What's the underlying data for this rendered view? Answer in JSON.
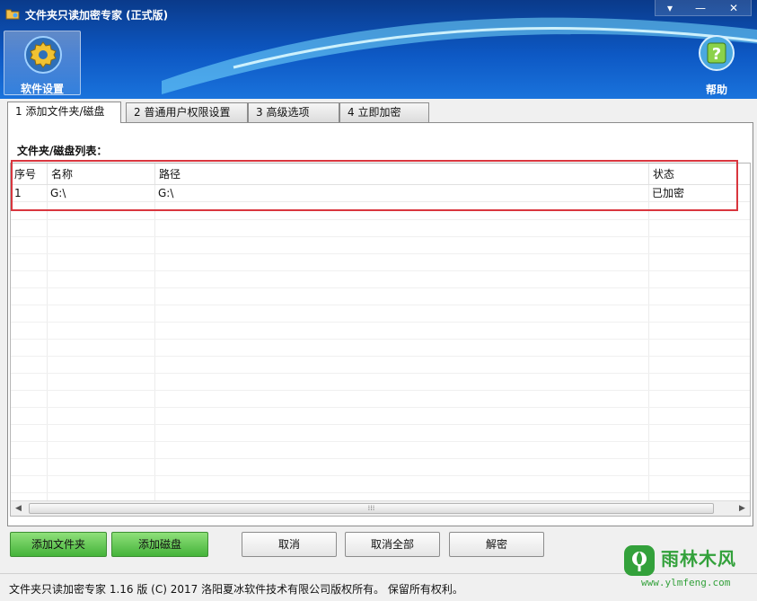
{
  "window": {
    "title": "文件夹只读加密专家 (正式版)",
    "controls": {
      "menu": "▾",
      "minimize": "—",
      "close": "✕"
    }
  },
  "toolbar": {
    "settings_label": "软件设置",
    "help_label": "帮助"
  },
  "tabs": [
    {
      "label": "1 添加文件夹/磁盘",
      "active": true
    },
    {
      "label": "2 普通用户权限设置",
      "active": false
    },
    {
      "label": "3 高级选项",
      "active": false
    },
    {
      "label": "4 立即加密",
      "active": false
    }
  ],
  "list": {
    "caption": "文件夹/磁盘列表：",
    "columns": [
      "序号",
      "名称",
      "路径",
      "状态"
    ],
    "rows": [
      {
        "index": "1",
        "name": "G:\\",
        "path": "G:\\",
        "status": "已加密"
      }
    ],
    "scroll_thumb": "⁞⁞⁞"
  },
  "buttons": {
    "add_folder": "添加文件夹",
    "add_disk": "添加磁盘",
    "cancel": "取消",
    "cancel_all": "取消全部",
    "decrypt": "解密"
  },
  "status_bar": {
    "copyright": "文件夹只读加密专家 1.16 版 (C) 2017 洛阳夏冰软件技术有限公司版权所有。 保留所有权利。"
  },
  "watermark": {
    "name": "雨林木风",
    "url": "www.ylmfeng.com"
  },
  "colors": {
    "banner_dark": "#0a3a8a",
    "banner_light": "#1a73dc",
    "highlight": "#d9363e",
    "green_button": "#45b33a",
    "watermark": "#33a13b"
  }
}
